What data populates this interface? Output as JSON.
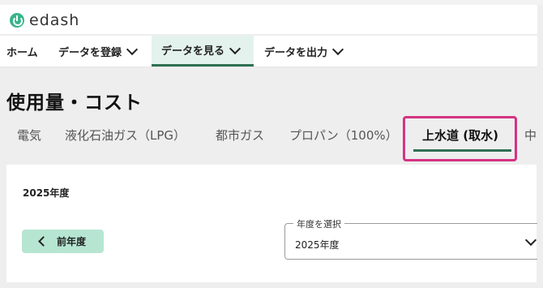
{
  "app": {
    "logo_text": "edash"
  },
  "nav": {
    "items": [
      {
        "label": "ホーム",
        "has_dropdown": false
      },
      {
        "label": "データを登録",
        "has_dropdown": true
      },
      {
        "label": "データを見る",
        "has_dropdown": true,
        "active": true
      },
      {
        "label": "データを出力",
        "has_dropdown": true
      }
    ]
  },
  "page": {
    "title": "使用量・コスト"
  },
  "tabs": [
    {
      "label": "電気"
    },
    {
      "label": "液化石油ガス（LPG）"
    },
    {
      "label": "都市ガス"
    },
    {
      "label": "プロパン（100%）"
    },
    {
      "label": "上水道 (取水)",
      "active": true
    },
    {
      "label": "中"
    }
  ],
  "content": {
    "year_label": "2025年度",
    "prev_button_label": "前年度",
    "year_select": {
      "legend": "年度を選択",
      "value": "2025年度"
    }
  },
  "colors": {
    "accent": "#2f6f53",
    "button_bg": "#b6e6d2",
    "highlight": "#d63384",
    "logo": "#39b48a"
  }
}
